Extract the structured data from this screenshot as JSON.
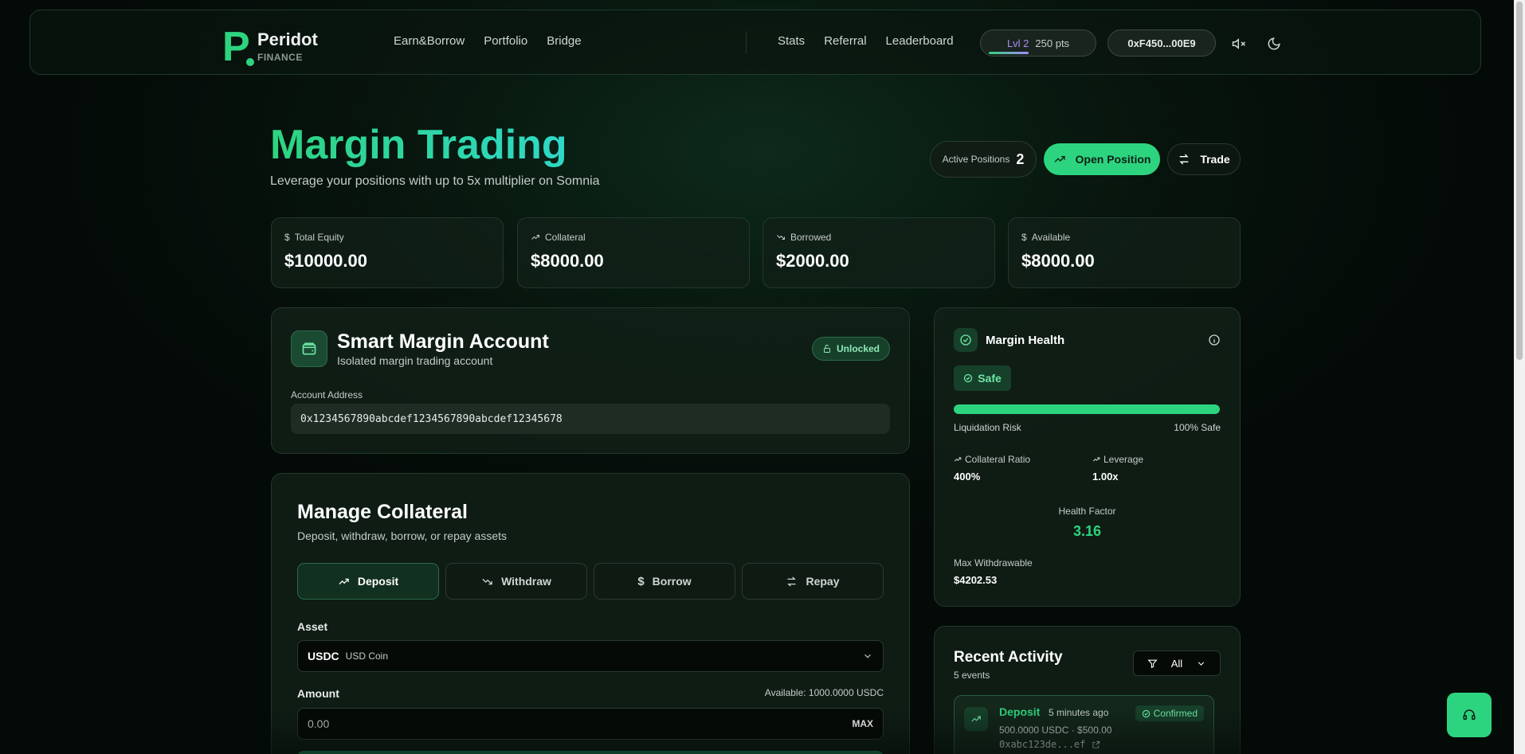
{
  "header": {
    "brand": "Peridot",
    "brand_sub": "FINANCE",
    "nav_left": [
      "Earn&Borrow",
      "Portfolio",
      "Bridge"
    ],
    "nav_right": [
      "Stats",
      "Referral",
      "Leaderboard"
    ],
    "level": "Lvl 2",
    "points": "250 pts",
    "wallet": "0xF450...00E9",
    "icons": [
      "mute-icon",
      "moon-icon"
    ]
  },
  "page": {
    "title": "Margin Trading",
    "subtitle": "Leverage your positions with up to 5x multiplier on Somnia",
    "active_positions_label": "Active Positions",
    "active_positions_count": "2",
    "open_position_label": "Open Position",
    "trade_label": "Trade"
  },
  "stats": [
    {
      "label": "Total Equity",
      "value": "$10000.00",
      "icon": "dollar-icon"
    },
    {
      "label": "Collateral",
      "value": "$8000.00",
      "icon": "trending-up-icon"
    },
    {
      "label": "Borrowed",
      "value": "$2000.00",
      "icon": "trending-down-icon"
    },
    {
      "label": "Available",
      "value": "$8000.00",
      "icon": "dollar-icon"
    }
  ],
  "sma": {
    "title": "Smart Margin Account",
    "subtitle": "Isolated margin trading account",
    "status": "Unlocked",
    "address_label": "Account Address",
    "address": "0x1234567890abcdef1234567890abcdef12345678"
  },
  "collateral": {
    "title": "Manage Collateral",
    "subtitle": "Deposit, withdraw, borrow, or repay assets",
    "tabs": [
      "Deposit",
      "Withdraw",
      "Borrow",
      "Repay"
    ],
    "active_tab": "Deposit",
    "asset_label": "Asset",
    "asset_symbol": "USDC",
    "asset_name": "USD Coin",
    "amount_label": "Amount",
    "available": "Available: 1000.0000 USDC",
    "amount_value": "0.00",
    "max_label": "MAX"
  },
  "health": {
    "title": "Margin Health",
    "status": "Safe",
    "health_fraction": 1.0,
    "risk_label": "Liquidation Risk",
    "risk_value": "100% Safe",
    "collateral_ratio_label": "Collateral Ratio",
    "collateral_ratio": "400%",
    "leverage_label": "Leverage",
    "leverage": "1.00x",
    "health_factor_label": "Health Factor",
    "health_factor": "3.16",
    "max_withdrawable_label": "Max Withdrawable",
    "max_withdrawable": "$4202.53"
  },
  "activity": {
    "title": "Recent Activity",
    "count": "5 events",
    "filter": "All",
    "events": [
      {
        "type": "Deposit",
        "time": "5 minutes ago",
        "status": "Confirmed",
        "amount": "500.0000 USDC · $500.00",
        "tx": "0xabc123de...ef"
      }
    ]
  },
  "colors": {
    "accent": "#2dd47f",
    "background": "#07140d",
    "level_purple": "#a78bfa"
  }
}
